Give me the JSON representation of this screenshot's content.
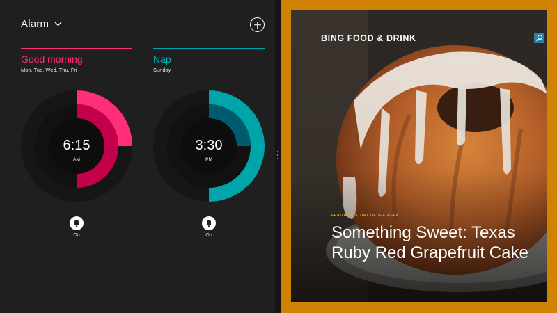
{
  "alarms_app": {
    "title": "Alarm",
    "add_icon": "plus-circle-icon",
    "alarms": [
      {
        "name": "Good morning",
        "days": "Mon, Tue, Wed, Thu, Fri",
        "time": "6:15",
        "ampm": "AM",
        "toggle_icon": "bell-icon",
        "status": "On",
        "accent_color": "#ff2d7a",
        "accent_dark": "#c3004a"
      },
      {
        "name": "Nap",
        "days": "Sunday",
        "time": "3:30",
        "ampm": "PM",
        "toggle_icon": "bell-icon",
        "status": "On",
        "accent_color": "#00a5ac",
        "accent_dark": "#005b6e"
      }
    ]
  },
  "food_app": {
    "title": "BING FOOD & DRINK",
    "search_icon": "search-icon",
    "featured_label": "FEATURED STORY",
    "featured_sep": "OF THE WEEK",
    "headline": "Something Sweet: Texas Ruby Red Grapefruit Cake",
    "frame_color": "#cf8300"
  }
}
